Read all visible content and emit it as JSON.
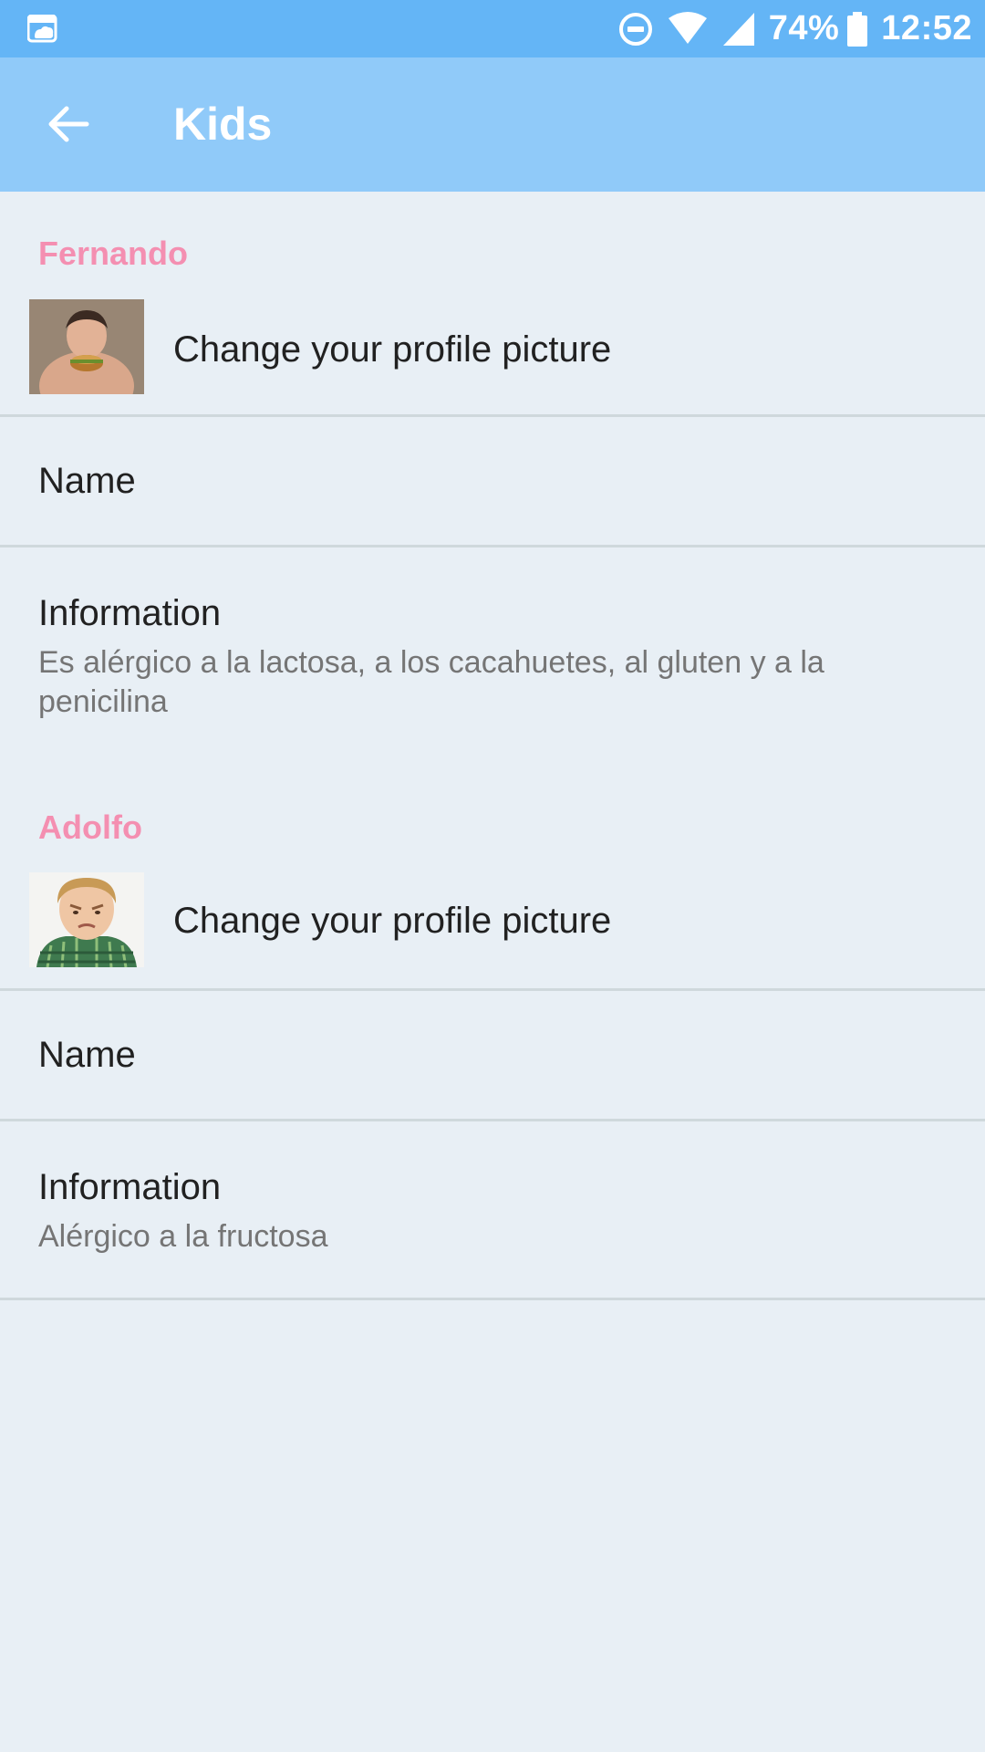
{
  "status_bar": {
    "app_icon": "cloud-app-icon",
    "battery": "74%",
    "time": "12:52",
    "icons": [
      "dnd-icon",
      "wifi-icon",
      "signal-icon",
      "battery-icon"
    ]
  },
  "app_bar": {
    "title": "Kids",
    "back_icon": "arrow-back-icon"
  },
  "kids": [
    {
      "name": "Fernando",
      "picture_label": "Change your profile picture",
      "name_label": "Name",
      "info_label": "Information",
      "info_value": "Es alérgico a la lactosa, a los cacahuetes, al gluten y a la penicilina"
    },
    {
      "name": "Adolfo",
      "picture_label": "Change your profile picture",
      "name_label": "Name",
      "info_label": "Information",
      "info_value": "Alérgico a la fructosa"
    }
  ],
  "colors": {
    "status_bar": "#64b5f6",
    "app_bar": "#90caf9",
    "accent_pink": "#f48fb1",
    "background": "#e8eff5"
  }
}
